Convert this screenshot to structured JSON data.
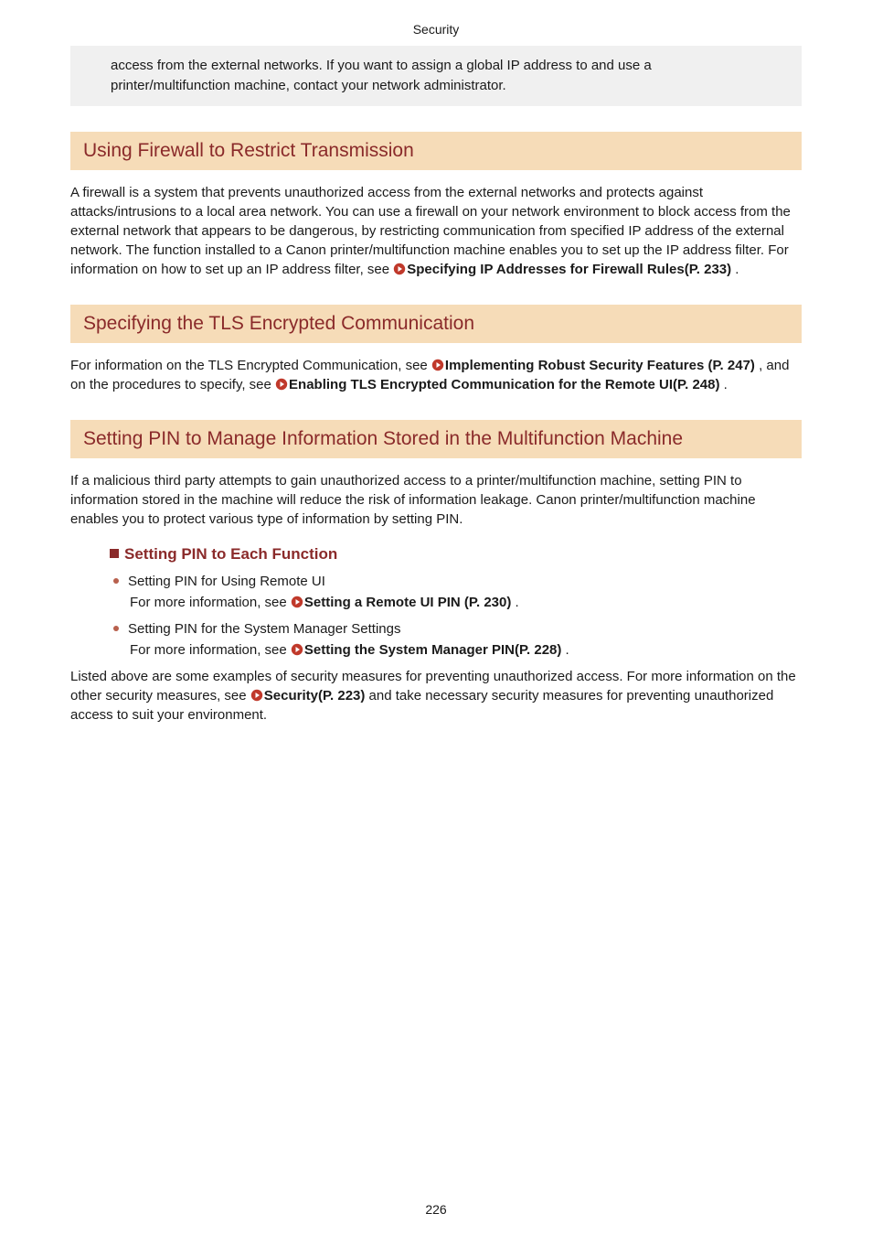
{
  "header": {
    "title": "Security"
  },
  "noteBox": {
    "text": "access from the external networks. If you want to assign a global IP address to and use a printer/multifunction machine, contact your network administrator."
  },
  "section_firewall": {
    "heading": "Using Firewall to Restrict Transmission",
    "body_before_link": "A firewall is a system that prevents unauthorized access from the external networks and protects against attacks/intrusions to a local area network. You can use a firewall on your network environment to block access from the external network that appears to be dangerous, by restricting communication from specified IP address of the external network. The function installed to a Canon printer/multifunction machine enables you to set up the IP address filter. For information on how to set up an IP address filter, see ",
    "link1": "Specifying IP Addresses for Firewall Rules(P. 233)",
    "body_after_link": " ."
  },
  "section_tls": {
    "heading": "Specifying the TLS Encrypted Communication",
    "body1": "For information on the TLS Encrypted Communication, see ",
    "link1": "Implementing Robust Security Features (P. 247)",
    "body2": " , and on the procedures to specify, see ",
    "link2": "Enabling TLS Encrypted Communication for the Remote UI(P. 248)",
    "body3": " ."
  },
  "section_pin": {
    "heading": "Setting PIN to Manage Information Stored in the Multifunction Machine",
    "body": "If a malicious third party attempts to gain unauthorized access to a printer/multifunction machine, setting PIN to information stored in the machine will reduce the risk of information leakage. Canon printer/multifunction machine enables you to protect various type of information by setting PIN.",
    "sub_heading": "Setting PIN to Each Function",
    "bullets": {
      "b1_title": "Setting PIN for Using Remote UI",
      "b1_prefix": "For more information, see ",
      "b1_link": "Setting a Remote UI PIN (P. 230)",
      "b1_suffix": " .",
      "b2_title": "Setting PIN for the System Manager Settings",
      "b2_prefix": "For more information, see  ",
      "b2_link": "Setting the System Manager PIN(P. 228)",
      "b2_suffix": " ."
    },
    "closing_before": "Listed above are some examples of security measures for preventing unauthorized access. For more information on the other security measures, see ",
    "closing_link": "Security(P. 223)",
    "closing_after": "  and take necessary security measures for preventing unauthorized access to suit your environment."
  },
  "footer": {
    "page_number": "226"
  },
  "colors": {
    "accent": "#8a2a2a",
    "section_bg": "#f6dcb8",
    "note_bg": "#f0f0f0",
    "link_icon": "#c0392b"
  }
}
